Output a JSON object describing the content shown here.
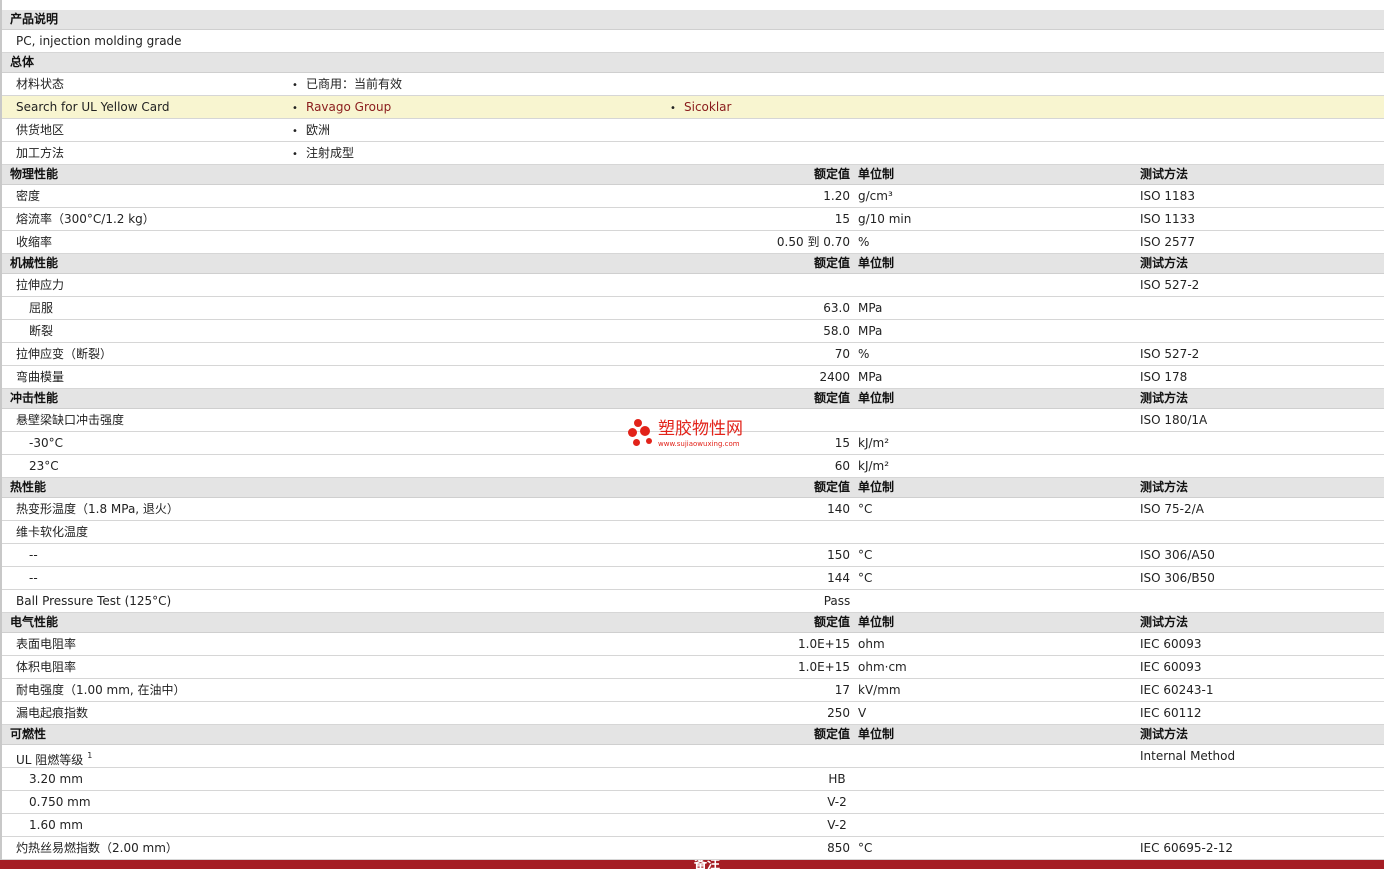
{
  "sections": {
    "product_desc": "产品说明",
    "product_desc_value": "PC, injection molding grade",
    "general": "总体",
    "physical": "物理性能",
    "mechanical": "机械性能",
    "impact": "冲击性能",
    "thermal": "热性能",
    "electrical": "电气性能",
    "flammability": "可燃性"
  },
  "columns": {
    "nominal": "额定值",
    "unit": "单位制",
    "method": "测试方法"
  },
  "general": {
    "material_status_label": "材料状态",
    "material_status_value": "已商用：当前有效",
    "ul_label": "Search for UL Yellow Card",
    "ul_link1": "Ravago Group",
    "ul_link2": "Sicoklar",
    "availability_label": "供货地区",
    "availability_value": "欧洲",
    "processing_label": "加工方法",
    "processing_value": "注射成型"
  },
  "bullet": "•",
  "physical": {
    "density": {
      "label": "密度",
      "value": "1.20",
      "unit": "g/cm³",
      "method": "ISO 1183"
    },
    "mfr": {
      "label": "熔流率（300°C/1.2 kg）",
      "value": "15",
      "unit": "g/10 min",
      "method": "ISO 1133"
    },
    "shrink": {
      "label": "收缩率",
      "value": "0.50 到  0.70",
      "unit": "%",
      "method": "ISO 2577"
    }
  },
  "mechanical": {
    "tensile_stress": {
      "label": "拉伸应力",
      "method": "ISO 527-2"
    },
    "yield": {
      "label": "屈服",
      "value": "63.0",
      "unit": "MPa"
    },
    "break": {
      "label": "断裂",
      "value": "58.0",
      "unit": "MPa"
    },
    "tensile_strain": {
      "label": "拉伸应变（断裂）",
      "value": "70",
      "unit": "%",
      "method": "ISO 527-2"
    },
    "flex_modulus": {
      "label": "弯曲模量",
      "value": "2400",
      "unit": "MPa",
      "method": "ISO 178"
    }
  },
  "impact": {
    "izod": {
      "label": "悬壁梁缺口冲击强度",
      "method": "ISO 180/1A"
    },
    "m30": {
      "label": "-30°C",
      "value": "15",
      "unit": "kJ/m²"
    },
    "p23": {
      "label": "23°C",
      "value": "60",
      "unit": "kJ/m²"
    }
  },
  "thermal": {
    "hdt": {
      "label": "热变形温度（1.8 MPa, 退火）",
      "value": "140",
      "unit": "°C",
      "method": "ISO 75-2/A"
    },
    "vicat": {
      "label": "维卡软化温度"
    },
    "vicat_a": {
      "label": "--",
      "value": "150",
      "unit": "°C",
      "method": "ISO 306/A50"
    },
    "vicat_b": {
      "label": "--",
      "value": "144",
      "unit": "°C",
      "method": "ISO 306/B50"
    },
    "ball": {
      "label": "Ball Pressure Test (125°C)",
      "value": "Pass"
    }
  },
  "electrical": {
    "surface": {
      "label": "表面电阻率",
      "value": "1.0E+15",
      "unit": "ohm",
      "method": "IEC 60093"
    },
    "volume": {
      "label": "体积电阻率",
      "value": "1.0E+15",
      "unit": "ohm·cm",
      "method": "IEC 60093"
    },
    "dielectric": {
      "label": "耐电强度（1.00 mm, 在油中）",
      "value": "17",
      "unit": "kV/mm",
      "method": "IEC 60243-1"
    },
    "cti": {
      "label": "漏电起痕指数",
      "value": "250",
      "unit": "V",
      "method": "IEC 60112"
    }
  },
  "flammability": {
    "ul": {
      "label": "UL 阻燃等级",
      "sup": "1",
      "method": "Internal Method"
    },
    "t320": {
      "label": "3.20 mm",
      "value": "HB"
    },
    "t075": {
      "label": "0.750 mm",
      "value": "V-2"
    },
    "t160": {
      "label": "1.60 mm",
      "value": "V-2"
    },
    "gwfi": {
      "label": "灼热丝易燃指数（2.00 mm）",
      "value": "850",
      "unit": "°C",
      "method": "IEC 60695-2-12"
    }
  },
  "footer": {
    "label": "备注"
  },
  "watermark": {
    "text": "塑胶物性网",
    "url": "www.sujiaowuxing.com",
    "color": "#e2231a"
  },
  "colors": {
    "header_bg": "#e4e4e4",
    "highlight_bg": "#f8f5d0",
    "link": "#8a1c1c",
    "footer_bar": "#a51d24"
  }
}
